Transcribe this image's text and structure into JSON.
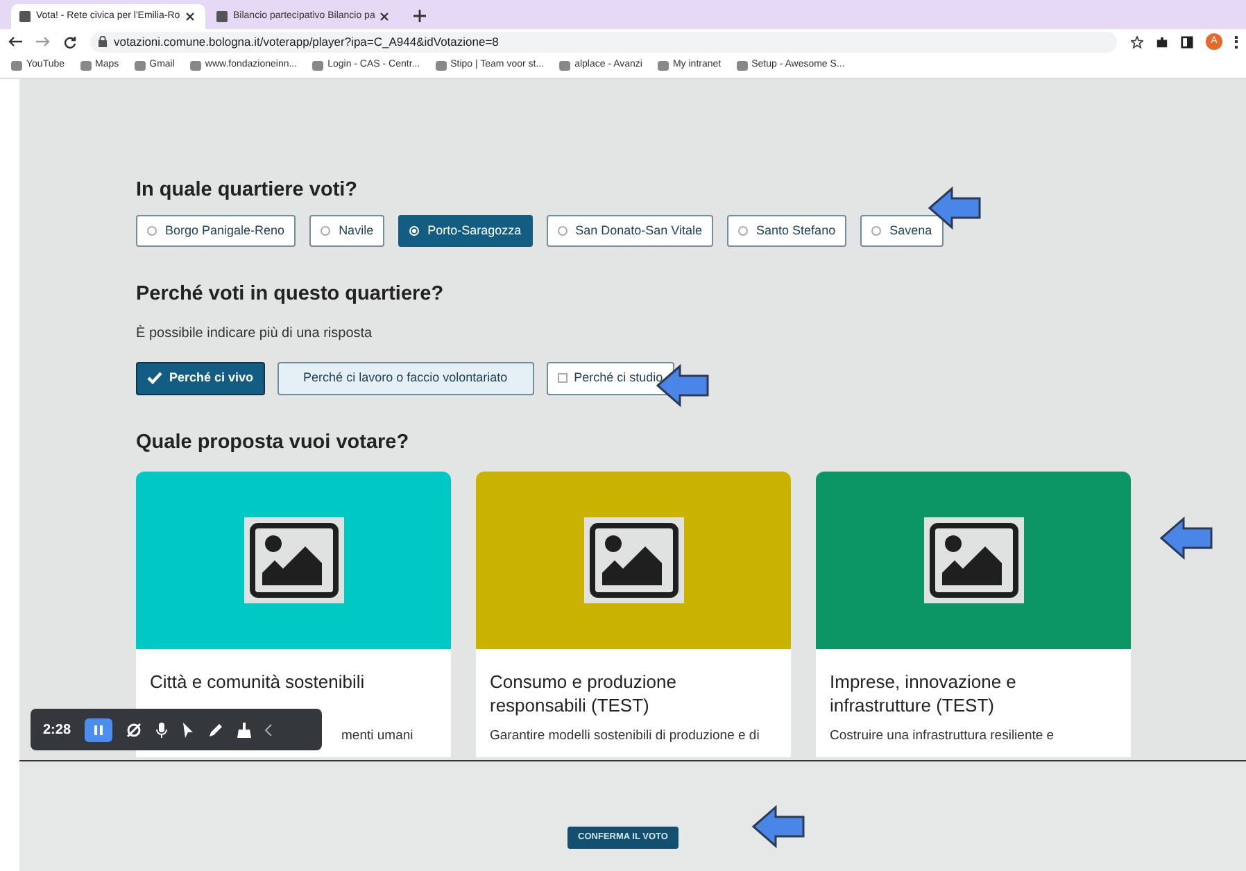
{
  "browser": {
    "tabs": [
      {
        "title": "Vota! - Rete civica per l'Emilia-Ro",
        "selected": true
      },
      {
        "title": "Bilancio partecipativo Bilancio pa",
        "selected": false
      }
    ],
    "url": "votazioni.comune.bologna.it/voterapp/player?ipa=C_A944&idVotazione=8",
    "bookmarks": [
      "YouTube",
      "Maps",
      "Gmail",
      "www.fondazioneinn...",
      "Login - CAS - Centr...",
      "Stipo | Team voor st...",
      "alplace - Avanzi",
      "My intranet",
      "Setup - Awesome S..."
    ],
    "profile_initial": "A"
  },
  "quartiere": {
    "title": "In quale quartiere voti?",
    "options": [
      {
        "label": "Borgo Panigale-Reno",
        "selected": false
      },
      {
        "label": "Navile",
        "selected": false
      },
      {
        "label": "Porto-Saragozza",
        "selected": true
      },
      {
        "label": "San Donato-San Vitale",
        "selected": false
      },
      {
        "label": "Santo Stefano",
        "selected": false
      },
      {
        "label": "Savena",
        "selected": false
      }
    ]
  },
  "motivo": {
    "title": "Perché voti in questo quartiere?",
    "hint": "È possibile indicare più di una risposta",
    "options": [
      {
        "label": "Perché ci vivo",
        "checked": true
      },
      {
        "label": "Perché ci lavoro o faccio volontariato",
        "checked": false
      },
      {
        "label": "Perché ci studio",
        "checked": false
      }
    ]
  },
  "proposte": {
    "title": "Quale proposta vuoi votare?",
    "cards": [
      {
        "title": "Città e comunità sostenibili",
        "description": "menti umani",
        "color": "#00c8c4"
      },
      {
        "title": "Consumo e produzione responsabili (TEST)",
        "description": "Garantire modelli sostenibili di produzione e di",
        "color": "#c9b200"
      },
      {
        "title": "Imprese, innovazione e infrastrutture (TEST)",
        "description": "Costruire una infrastruttura resiliente e",
        "color": "#0c9666"
      }
    ]
  },
  "confirm_button": "CONFERMA IL VOTO",
  "recorder": {
    "time": "2:28"
  }
}
